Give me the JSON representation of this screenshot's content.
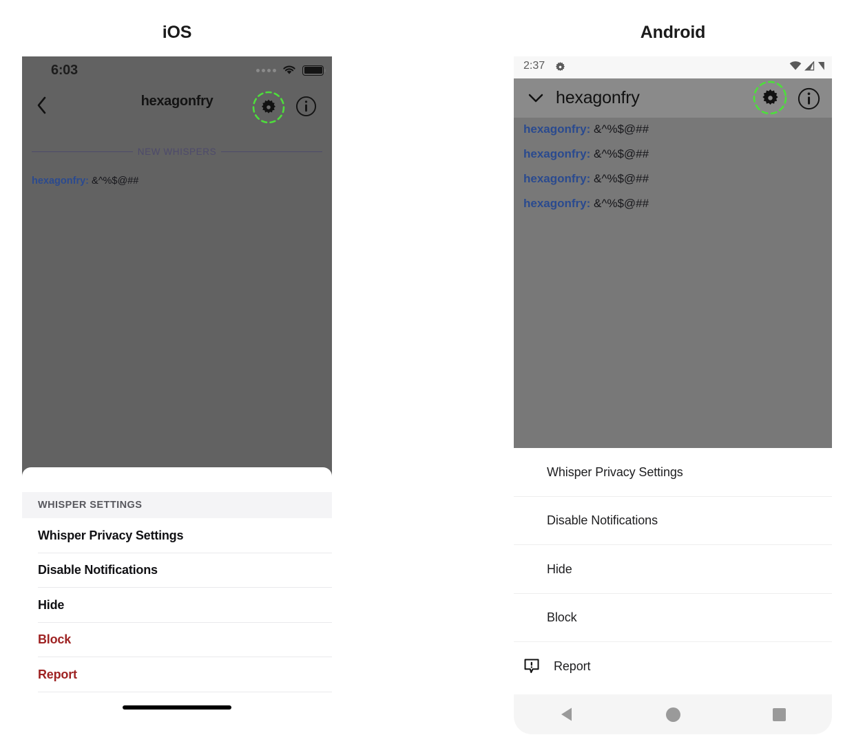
{
  "titles": {
    "ios": "iOS",
    "android": "Android"
  },
  "colors": {
    "highlight_ring": "#4ede3c",
    "username_blue": "#2b4a8f",
    "destructive_red": "#9e2222",
    "ios_dim_overlay": "#626262",
    "android_dim_overlay": "#787878",
    "android_appbar": "#8a8a8a"
  },
  "ios": {
    "status_bar": {
      "time": "6:03",
      "signal_icon": "signal-dots-icon",
      "wifi_icon": "wifi-icon",
      "battery_icon": "battery-full-icon"
    },
    "nav_bar": {
      "back_icon": "chevron-left-icon",
      "title": "hexagonfry",
      "settings_icon": "gear-icon",
      "info_icon": "info-circle-icon",
      "settings_highlighted": true
    },
    "conversation": {
      "divider_label": "NEW WHISPERS",
      "messages": [
        {
          "user": "hexagonfry:",
          "text": "&^%$@##"
        }
      ]
    },
    "sheet": {
      "section_header": "WHISPER SETTINGS",
      "items": [
        {
          "label": "Whisper Privacy Settings",
          "destructive": false
        },
        {
          "label": "Disable Notifications",
          "destructive": false
        },
        {
          "label": "Hide",
          "destructive": false
        },
        {
          "label": "Block",
          "destructive": true
        },
        {
          "label": "Report",
          "destructive": true
        }
      ]
    },
    "home_indicator": "home-indicator"
  },
  "android": {
    "status_bar": {
      "time": "2:37",
      "status_gear_icon": "gear-icon",
      "wifi_icon": "wifi-icon",
      "signal_icon": "signal-icon",
      "battery_icon": "battery-icon"
    },
    "app_bar": {
      "collapse_icon": "chevron-down-icon",
      "title": "hexagonfry",
      "settings_icon": "gear-icon",
      "info_icon": "info-circle-icon",
      "settings_highlighted": true
    },
    "conversation": {
      "messages": [
        {
          "user": "hexagonfry:",
          "text": "&^%$@##"
        },
        {
          "user": "hexagonfry:",
          "text": "&^%$@##"
        },
        {
          "user": "hexagonfry:",
          "text": "&^%$@##"
        },
        {
          "user": "hexagonfry:",
          "text": "&^%$@##"
        }
      ]
    },
    "menu": {
      "items": [
        {
          "label": "Whisper Privacy Settings",
          "icon": null
        },
        {
          "label": "Disable Notifications",
          "icon": null
        },
        {
          "label": "Hide",
          "icon": null
        },
        {
          "label": "Block",
          "icon": null
        },
        {
          "label": "Report",
          "icon": "report-flag-icon"
        }
      ]
    },
    "nav_bar": {
      "back": "back-triangle-icon",
      "home": "home-circle-icon",
      "recents": "recents-square-icon"
    }
  }
}
